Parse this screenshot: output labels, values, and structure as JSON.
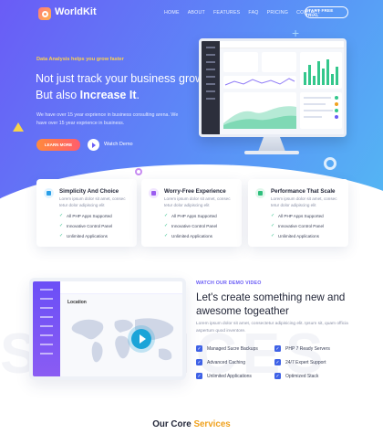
{
  "nav": {
    "logo_text": "WorldKit",
    "menu": [
      "HOME",
      "ABOUT",
      "FEATURES",
      "FAQ",
      "PRICING",
      "CONTACT"
    ],
    "trial_button": "START FREE TRIAL"
  },
  "hero": {
    "eyebrow": "Data Analysis helps you grow faster",
    "headline_part1": "Not just track your business growth, But also ",
    "headline_bold": "Increase It",
    "headline_end": ".",
    "description": "We have over 15 year exprience in business consulting arena. We have over 15 year exprience in business.",
    "learn_button": "LEARN MORE",
    "watch_demo": "Watch Demo"
  },
  "features": [
    {
      "title": "Simplicity And Choice",
      "description": "Lorem ipsum dolor sit amet, consec tetur dolor adipiscing elit",
      "items": [
        "All PHP Apps Supported",
        "Innovative Control Panel",
        "Unlimited Applications"
      ],
      "icon": "shield-icon",
      "icon_bg": "#e3f4ff",
      "icon_color": "#2a9fe8"
    },
    {
      "title": "Worry-Free Experience",
      "description": "Lorem ipsum dolor sit amet, consec tetur dolor adipiscing elit",
      "items": [
        "All PHP Apps Supported",
        "Innovative Control Panel",
        "Unlimited Applications"
      ],
      "icon": "user-icon",
      "icon_bg": "#f1e6ff",
      "icon_color": "#9b5cf0"
    },
    {
      "title": "Performance That Scale",
      "description": "Lorem ipsum dolor sit amet, consec tetur dolor adipiscing elit",
      "items": [
        "All PHP Apps Supported",
        "Innovative Control Panel",
        "Unlimited Applications"
      ],
      "icon": "chart-icon",
      "icon_bg": "#e2f7ec",
      "icon_color": "#2fbf7d"
    }
  ],
  "video": {
    "label": "WATCH OUR DEMO VIDEO",
    "heading": "Let's create something new and awesome togeather",
    "description": "Lorem ipsum dolor sit amet, consectetur adipisicing elit. Ipsum sit, quam officia aspertum quod inventore.",
    "frame_title": "Location",
    "features": [
      "Managed Sucre Backups",
      "PHP 7 Ready Servers",
      "Advanced Caching",
      "24/7 Expert Support",
      "Unlimited Applications",
      "Optimized Stack"
    ],
    "background_word": "SERVICES"
  },
  "core": {
    "title": "Our Core ",
    "accent": "Services"
  },
  "colors": {
    "brand_purple": "#6a5cf6",
    "accent_orange": "#f0a21f",
    "check_green": "#35c28d",
    "check_blue": "#3f62e6"
  }
}
